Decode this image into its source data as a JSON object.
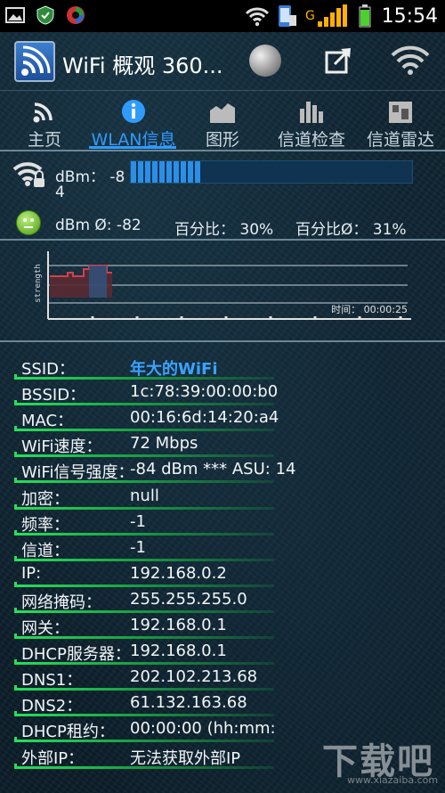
{
  "status_bar": {
    "time": "15:54",
    "icons": [
      "image-icon",
      "shield-icon",
      "app-icon",
      "wifi-icon",
      "phone-icon",
      "signal-icon",
      "battery-icon"
    ]
  },
  "app_bar": {
    "title": "WiFi 概观 360...",
    "icons": [
      "app-logo-icon",
      "globe-icon",
      "share-icon",
      "wifi-settings-icon"
    ]
  },
  "tabs": [
    {
      "label": "主页",
      "icon": "wifi-icon"
    },
    {
      "label": "WLAN信息",
      "icon": "info-icon",
      "active": true
    },
    {
      "label": "图形",
      "icon": "area-chart-icon"
    },
    {
      "label": "信道检查",
      "icon": "bar-chart-icon"
    },
    {
      "label": "信道雷达",
      "icon": "channel-radar-icon"
    }
  ],
  "signal": {
    "dbm_label": "dBm： -8",
    "dbm_wrap": "4",
    "level_fraction": 0.25,
    "avg_dbm": "dBm Ø: -82",
    "percent": "百分比： 30%",
    "percent_avg": "百分比Ø： 31%"
  },
  "graph": {
    "ylabel": "strength",
    "time_label": "时间： 00:00:25"
  },
  "info": [
    {
      "key": "SSID：",
      "value": "年大的WiFi"
    },
    {
      "key": "BSSID：",
      "value": "1c:78:39:00:00:b0"
    },
    {
      "key": "MAC：",
      "value": "00:16:6d:14:20:a4"
    },
    {
      "key": "WiFi速度：",
      "value": "72 Mbps"
    },
    {
      "key": "WiFi信号强度：",
      "value": "-84 dBm *** ASU: 14"
    },
    {
      "key": "加密：",
      "value": "null"
    },
    {
      "key": "频率：",
      "value": "-1"
    },
    {
      "key": "信道：",
      "value": "-1"
    },
    {
      "key": "IP:",
      "value": "192.168.0.2"
    },
    {
      "key": "网络掩码：",
      "value": "255.255.255.0"
    },
    {
      "key": "网关：",
      "value": "192.168.0.1"
    },
    {
      "key": "DHCP服务器：",
      "value": "192.168.0.1"
    },
    {
      "key": "DNS1：",
      "value": "202.102.213.68"
    },
    {
      "key": "DNS2：",
      "value": "61.132.163.68"
    },
    {
      "key": "DHCP租约：",
      "value": "00:00:00 (hh:mm:"
    },
    {
      "key": "外部IP：",
      "value": "无法获取外部IP"
    }
  ],
  "watermark": {
    "text": "下载吧",
    "sub": "www.xiazaiba.com"
  },
  "colors": {
    "accent": "#2f9bff",
    "row_underline": "#25e05a",
    "level_fill": "#2a8fe6"
  }
}
